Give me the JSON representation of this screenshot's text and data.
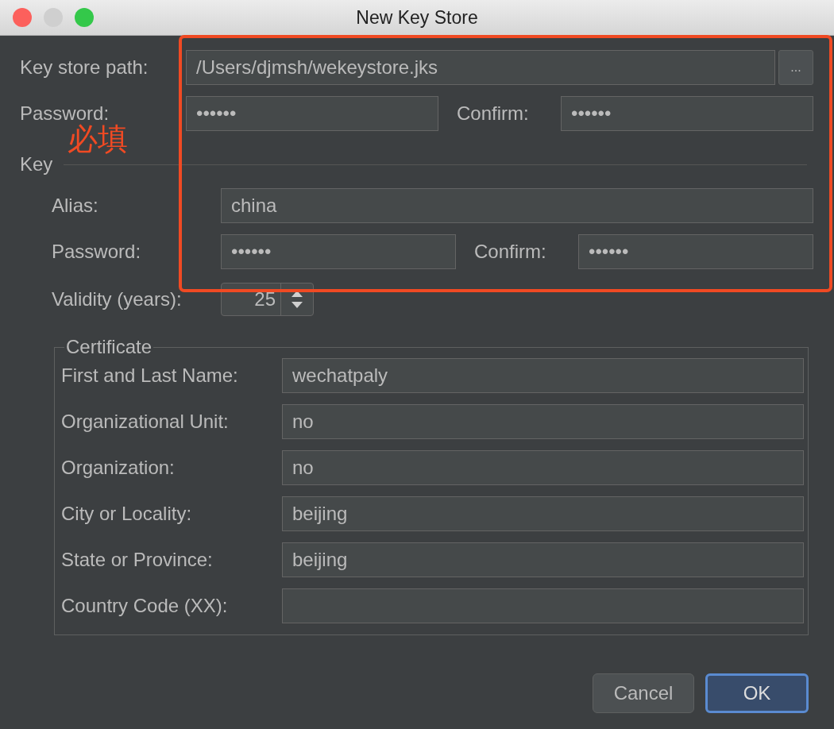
{
  "window": {
    "title": "New Key Store"
  },
  "key_store": {
    "path_label": "Key store path:",
    "path": "/Users/djmsh/wekeystore.jks",
    "browse_button": "...",
    "password_label": "Password:",
    "password": "••••••",
    "confirm_label": "Confirm:",
    "confirm": "••••••"
  },
  "annotation": {
    "text": "必填"
  },
  "key": {
    "section_label": "Key",
    "alias_label": "Alias:",
    "alias": "china",
    "password_label": "Password:",
    "password": "••••••",
    "confirm_label": "Confirm:",
    "confirm": "••••••",
    "validity_label": "Validity (years):",
    "validity": "25"
  },
  "certificate": {
    "title": "Certificate",
    "fields": [
      {
        "label": "First and Last Name:",
        "value": "wechatpaly"
      },
      {
        "label": "Organizational Unit:",
        "value": "no"
      },
      {
        "label": "Organization:",
        "value": "no"
      },
      {
        "label": "City or Locality:",
        "value": "beijing"
      },
      {
        "label": "State or Province:",
        "value": "beijing"
      },
      {
        "label": "Country Code (XX):"
      }
    ]
  },
  "buttons": [
    {
      "label": "Cancel",
      "default": false
    },
    {
      "label": "OK",
      "default": true
    }
  ]
}
